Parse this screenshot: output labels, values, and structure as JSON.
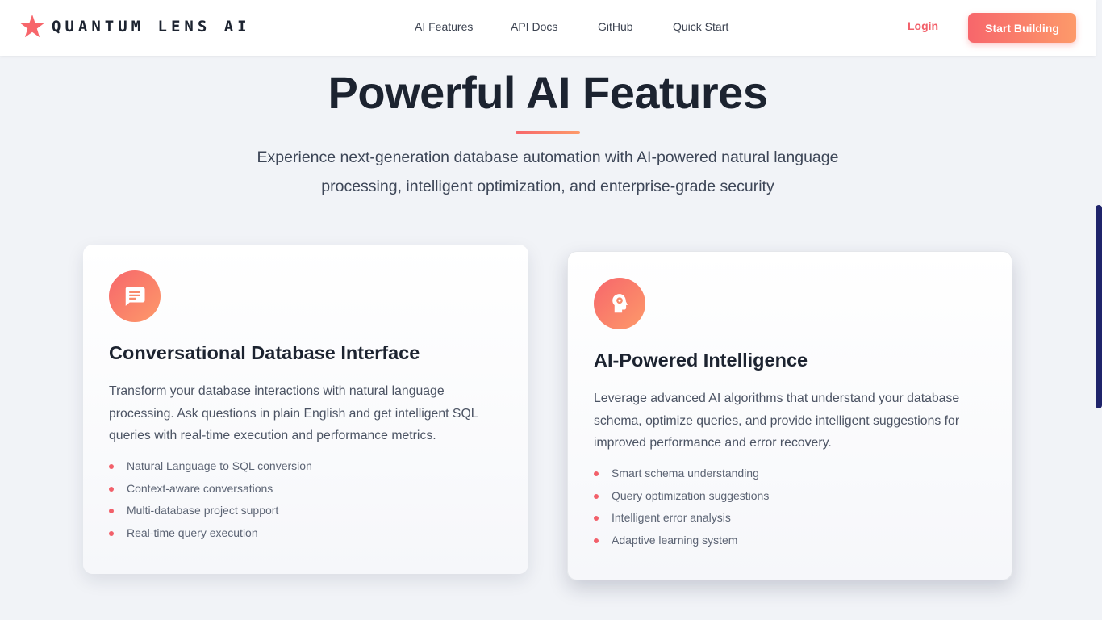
{
  "header": {
    "brand": "QUANTUM LENS AI",
    "brand_icon": "star-icon",
    "nav": [
      "AI Features",
      "API Docs",
      "GitHub",
      "Quick Start"
    ],
    "login_label": "Login",
    "cta_label": "Start Building"
  },
  "hero": {
    "title": "Powerful AI Features",
    "subtitle": "Experience next-generation database automation with AI-powered natural language processing, intelligent optimization, and enterprise-grade security"
  },
  "cards": [
    {
      "icon": "chat-icon",
      "title": "Conversational Database Interface",
      "description": "Transform your database interactions with natural language processing. Ask questions in plain English and get intelligent SQL queries with real-time execution and performance metrics.",
      "features": [
        "Natural Language to SQL conversion",
        "Context-aware conversations",
        "Multi-database project support",
        "Real-time query execution"
      ]
    },
    {
      "icon": "brain-head-icon",
      "title": "AI-Powered Intelligence",
      "description": "Leverage advanced AI algorithms that understand your database schema, optimize queries, and provide intelligent suggestions for improved performance and error recovery.",
      "features": [
        "Smart schema understanding",
        "Query optimization suggestions",
        "Intelligent error analysis",
        "Adaptive learning system"
      ]
    }
  ],
  "colors": {
    "accent": "#f7666b",
    "accent_end": "#fd9a6a",
    "login": "#f2606a",
    "heading": "#1c2330",
    "background": "#f1f3f7",
    "scrollbar": "#1f246b"
  }
}
